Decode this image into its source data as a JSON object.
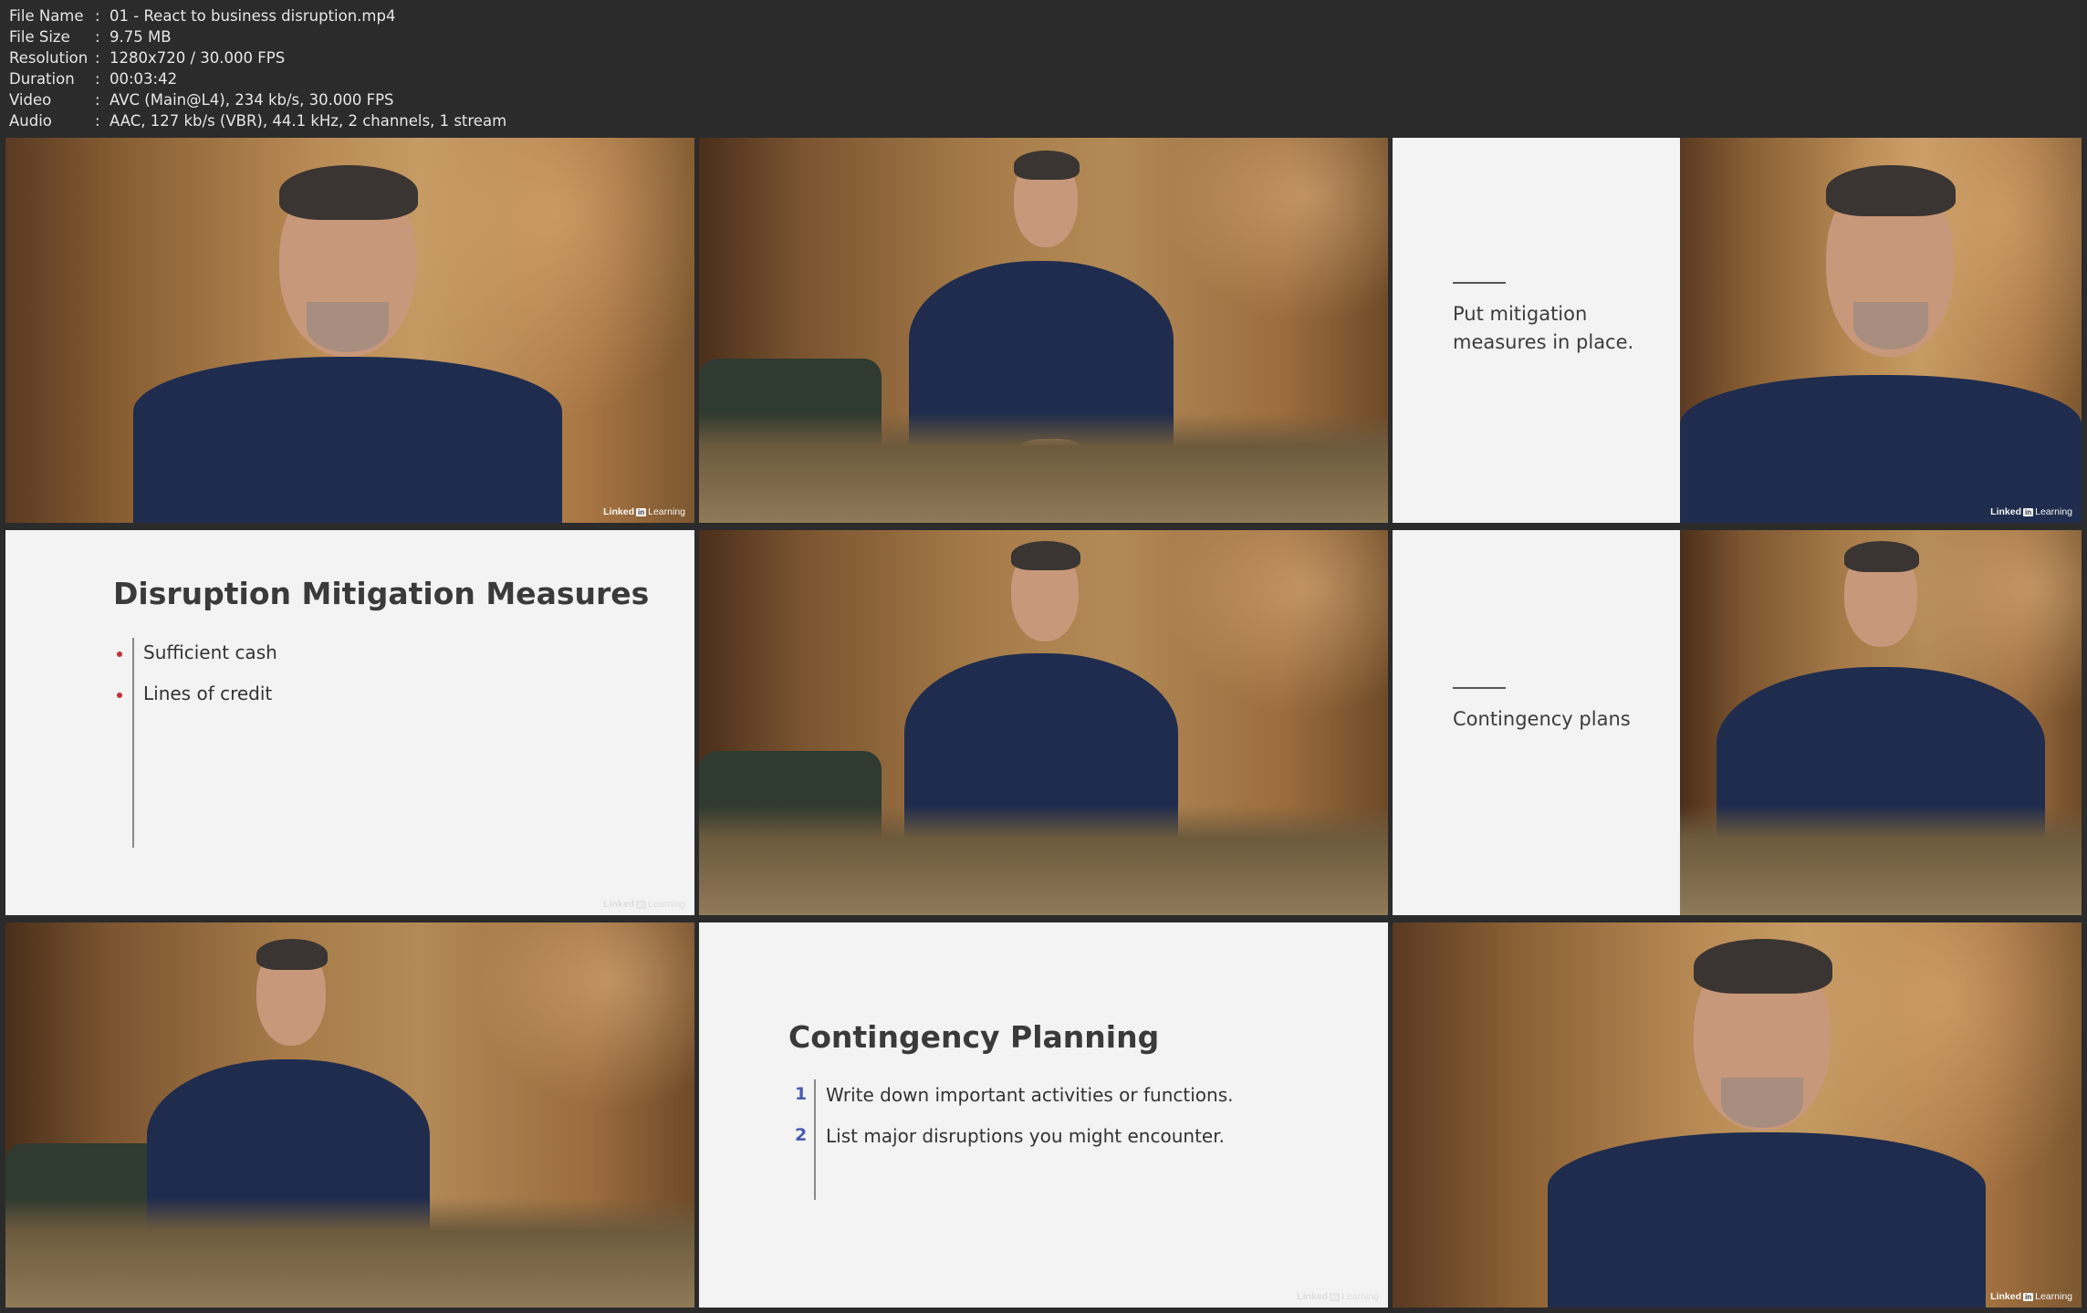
{
  "file_info": [
    {
      "key": "File Name",
      "value": "01 - React to business disruption.mp4"
    },
    {
      "key": "File Size",
      "value": "9.75 MB"
    },
    {
      "key": "Resolution",
      "value": "1280x720 / 30.000 FPS"
    },
    {
      "key": "Duration",
      "value": "00:03:42"
    },
    {
      "key": "Video",
      "value": "AVC (Main@L4), 234 kb/s, 30.000 FPS"
    },
    {
      "key": "Audio",
      "value": "AAC, 127 kb/s (VBR), 44.1 kHz, 2 channels, 1 stream"
    }
  ],
  "separator": ":",
  "watermark": {
    "linked": "Linked",
    "in": "in",
    "learning": "Learning"
  },
  "slides": {
    "mitigation_side": {
      "line1": "Put mitigation",
      "line2": "measures in place."
    },
    "measures": {
      "title": "Disruption Mitigation Measures",
      "bullets": [
        "Sufficient cash",
        "Lines of credit"
      ]
    },
    "contingency_side": {
      "text": "Contingency plans"
    },
    "planning": {
      "title": "Contingency Planning",
      "items": [
        {
          "num": "1",
          "text": "Write down important activities or functions."
        },
        {
          "num": "2",
          "text": "List major disruptions you might encounter."
        }
      ]
    }
  },
  "colors": {
    "shirt": "#1f2c4d",
    "bullet": "#c0303a",
    "number": "#4a5bb0"
  }
}
